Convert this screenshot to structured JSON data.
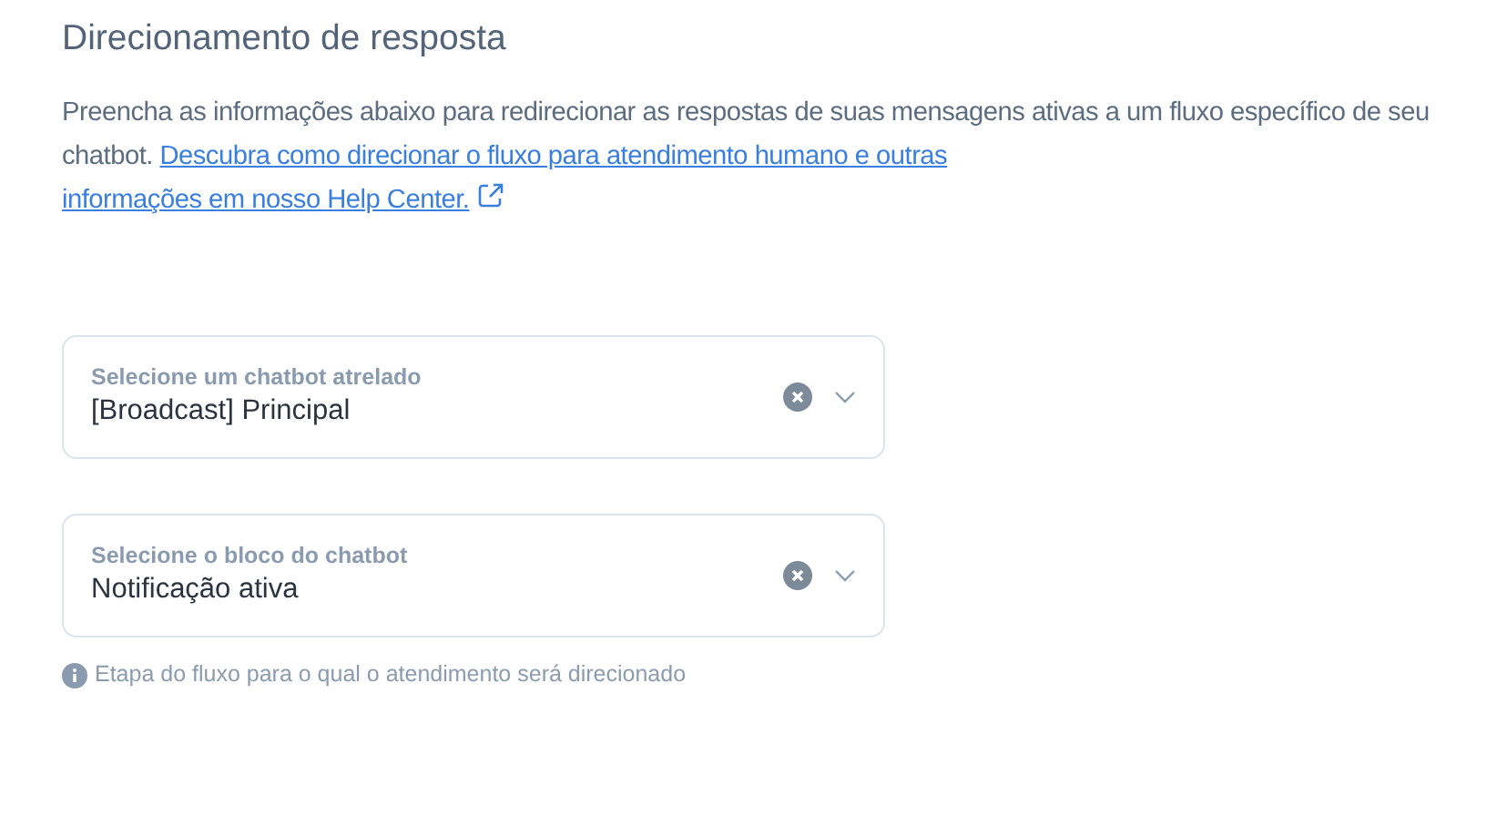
{
  "title": "Direcionamento de resposta",
  "description": {
    "text": "Preencha as informações abaixo para redirecionar as respostas de suas mensagens ativas a um fluxo específico de seu chatbot.",
    "link_lines": [
      "Descubra como direcionar o fluxo para atendimento humano e outras",
      "informações em nosso Help Center."
    ]
  },
  "fields": [
    {
      "label": "Selecione um chatbot atrelado",
      "value": "[Broadcast] Principal"
    },
    {
      "label": "Selecione o bloco do chatbot",
      "value": "Notificação ativa"
    }
  ],
  "hint": "Etapa do fluxo para o qual o atendimento será direcionado"
}
